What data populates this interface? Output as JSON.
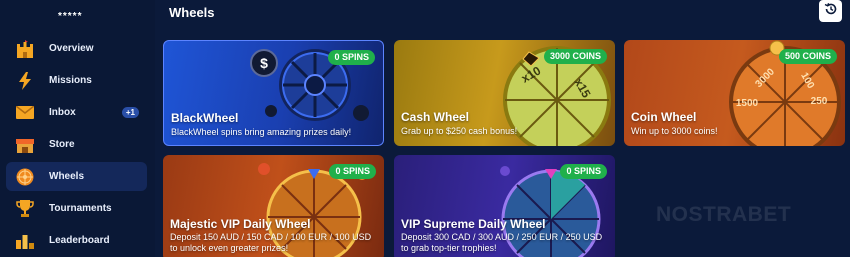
{
  "sidebar": {
    "rating": "*****",
    "items": [
      {
        "label": "Overview",
        "icon": "castle-icon",
        "active": false
      },
      {
        "label": "Missions",
        "icon": "lightning-icon",
        "active": false
      },
      {
        "label": "Inbox",
        "icon": "envelope-icon",
        "active": false,
        "badge": "+1"
      },
      {
        "label": "Store",
        "icon": "store-icon",
        "active": false
      },
      {
        "label": "Wheels",
        "icon": "wheel-icon",
        "active": true
      },
      {
        "label": "Tournaments",
        "icon": "trophy-icon",
        "active": false
      },
      {
        "label": "Leaderboard",
        "icon": "leaderboard-icon",
        "active": false
      }
    ]
  },
  "header": {
    "title": "Wheels",
    "history_icon": "history-icon"
  },
  "cards": [
    {
      "title": "BlackWheel",
      "desc": "BlackWheel spins bring amazing prizes daily!",
      "badge": "0 SPINS"
    },
    {
      "title": "Cash Wheel",
      "desc": "Grab up to $250 cash bonus!",
      "badge": "3000 COINS",
      "wheel_labels": [
        "x10",
        "x15"
      ]
    },
    {
      "title": "Coin Wheel",
      "desc": "Win up to 3000 coins!",
      "badge": "500 COINS",
      "wheel_labels": [
        "3000",
        "1500",
        "100",
        "250"
      ]
    },
    {
      "title": "Majestic VIP Daily Wheel",
      "desc": "Deposit 150 AUD / 150 CAD / 100 EUR / 100 USD to unlock even greater prizes!",
      "badge": "0 SPINS"
    },
    {
      "title": "VIP Supreme Daily Wheel",
      "desc": "Deposit 300 CAD / 300 AUD / 250 EUR / 250 USD to grab top-tier trophies!",
      "badge": "0 SPINS"
    }
  ],
  "watermark": "NOSTRABET",
  "colors": {
    "background": "#0b1a3a",
    "badge_green": "#20b04b",
    "active_nav": "#14285a"
  }
}
